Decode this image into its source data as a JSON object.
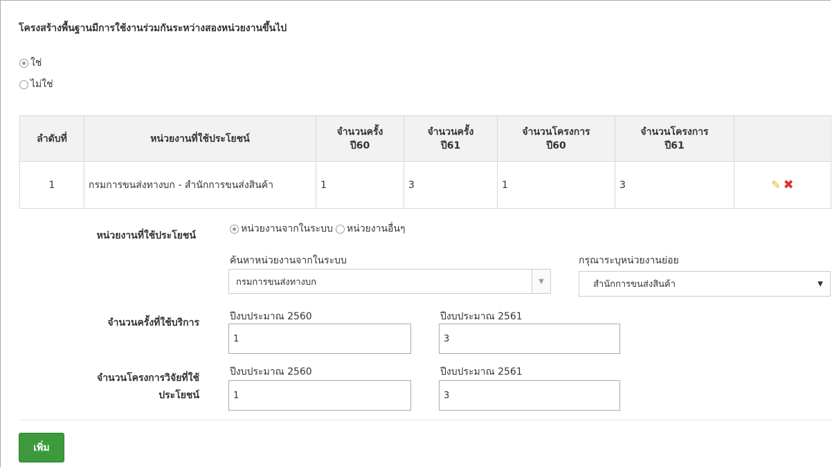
{
  "question": "โครงสร้างพื้นฐานมีการใช้งานร่วมกันระหว่างสองหน่วยงานขึ้นไป",
  "options": [
    {
      "label": "ใช่",
      "selected": true
    },
    {
      "label": "ไม่ใช่",
      "selected": false
    }
  ],
  "table": {
    "headers": [
      "ลำดับที่",
      "หน่วยงานที่ใช้ประโยชน์",
      "จำนวนครั้ง ปี60",
      "จำนวนครั้ง ปี61",
      "จำนวนโครงการ ปี60",
      "จำนวนโครงการ ปี61",
      ""
    ],
    "rows": [
      {
        "no": "1",
        "agency": "กรมการขนส่งทางบก - สำนักการขนส่งสินค้า",
        "times60": "1",
        "times61": "3",
        "projects60": "1",
        "projects61": "3"
      }
    ]
  },
  "form": {
    "agency_label": "หน่วยงานที่ใช้ประโยชน์",
    "agency_radio_internal": "หน่วยงานจากในระบบ",
    "agency_radio_other": "หน่วยงานอื่นๆ",
    "search_label": "ค้นหาหน่วยงานจากในระบบ",
    "search_value": "กรมการขนส่งทางบก",
    "sub_label": "กรุณาระบุหน่วยงานย่อย",
    "sub_value": "สำนักการขนส่งสินค้า",
    "times_label": "จำนวนครั้งที่ใช้บริการ",
    "year60_label": "ปีงบประมาณ 2560",
    "year61_label": "ปีงบประมาณ 2561",
    "times60_value": "1",
    "times61_value": "3",
    "projects_label_1": "จำนวนโครงการวิจัยที่ใช้",
    "projects_label_2": "ประโยชน์",
    "projects60_value": "1",
    "projects61_value": "3"
  },
  "add_button": "เพิ่ม",
  "colors": {
    "add_button": "#3c9a3c",
    "delete_icon": "#d9352a",
    "edit_icon": "#e8b12b"
  }
}
